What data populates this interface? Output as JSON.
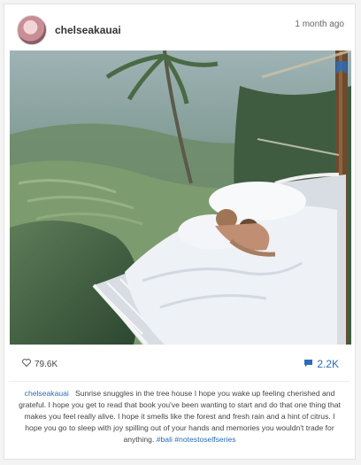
{
  "post": {
    "username": "chelseakauai",
    "time_ago": "1 month ago",
    "likes": "79.6K",
    "comments": "2.2K",
    "caption_user": "chelseakauai",
    "caption_text": "Sunrise snuggles in the tree house I hope you wake up feeling cherished and grateful. I hope you get to read that book you've been wanting to start and do that one thing that makes you feel really alive. I hope it smells like the forest and fresh rain and a hint of citrus. I hope you go to sleep with joy spilling out of your hands and memories you wouldn't trade for anything.",
    "caption_tags": "#bali #notestoselfseries"
  },
  "icons": {
    "like": "heart-outline-icon",
    "comment": "speech-bubble-icon",
    "save": "bookmark-icon"
  },
  "colors": {
    "accent": "#2a6dbb",
    "text": "#444444"
  }
}
